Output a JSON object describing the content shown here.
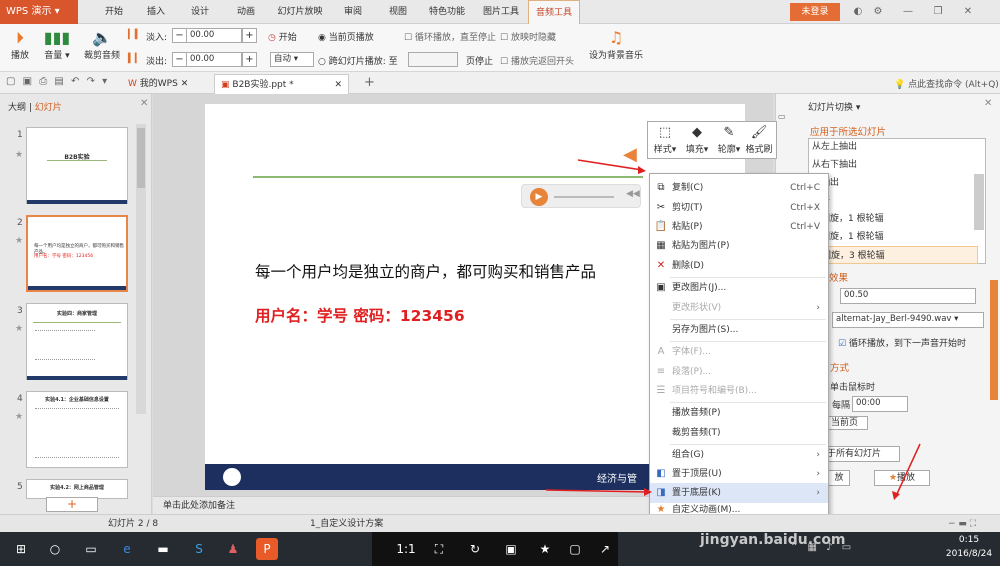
{
  "app": {
    "logo": "WPS 演示",
    "login": "未登录"
  },
  "menu_tabs": [
    "开始",
    "插入",
    "设计",
    "动画",
    "幻灯片放映",
    "审阅",
    "视图",
    "特色功能",
    "图片工具",
    "音频工具"
  ],
  "ribbon": {
    "play": "播放",
    "volume": "音量",
    "trim": "裁剪音频",
    "fade_in_label": "淡入:",
    "fade_in_value": "00.00",
    "fade_out_label": "淡出:",
    "fade_out_value": "00.00",
    "start_label": "开始",
    "start_value": "自动",
    "current_page": "当前页播放",
    "cross_slides": "跨幻灯片播放: 至",
    "page_stop": "页停止",
    "loop": "循环播放，直至停止",
    "hide_on_play": "放映时隐藏",
    "rewind": "播放完返回开头",
    "bg_music": "设为背景音乐"
  },
  "tabbar": {
    "mywps": "我的WPS",
    "doc": "B2B实验.ppt *",
    "search": "点此查找命令 (Alt+Q)"
  },
  "left_panel": {
    "outline": "大纲",
    "slides": "幻灯片"
  },
  "thumbs": [
    {
      "num": "1",
      "title": "B2B实验"
    },
    {
      "num": "2",
      "line1": "每一个用户均是独立的商户，都可购买和销售产品。",
      "line2": "用户名：学号 密码：123456"
    },
    {
      "num": "3",
      "title": "实验四：商家管理"
    },
    {
      "num": "4",
      "title": "实验4.1：企业基础信息设置"
    },
    {
      "num": "5",
      "title": "实验4.2：网上商品管理"
    }
  ],
  "slide": {
    "text1": "每一个用户均是独立的商户，都可购买和销售产品",
    "text2": "用户名：学号  密码：123456",
    "footer": "经济与管"
  },
  "mini_toolbar": [
    "样式",
    "填充",
    "轮廓",
    "格式刷"
  ],
  "context_menu": [
    {
      "icon": "copy",
      "label": "复制(C)",
      "shortcut": "Ctrl+C",
      "disabled": false
    },
    {
      "icon": "cut",
      "label": "剪切(T)",
      "shortcut": "Ctrl+X",
      "disabled": false
    },
    {
      "icon": "paste",
      "label": "粘贴(P)",
      "shortcut": "Ctrl+V",
      "disabled": false
    },
    {
      "icon": "paste-image",
      "label": "粘贴为图片(P)",
      "shortcut": "",
      "disabled": false
    },
    {
      "icon": "delete",
      "label": "删除(D)",
      "shortcut": "",
      "disabled": false
    },
    {
      "icon": "change-image",
      "label": "更改图片(J)...",
      "shortcut": "",
      "disabled": false
    },
    {
      "icon": "",
      "label": "更改形状(V)",
      "shortcut": "",
      "disabled": true
    },
    {
      "icon": "",
      "label": "另存为图片(S)...",
      "shortcut": "",
      "disabled": false
    },
    {
      "icon": "font",
      "label": "字体(F)...",
      "shortcut": "",
      "disabled": true
    },
    {
      "icon": "paragraph",
      "label": "段落(P)...",
      "shortcut": "",
      "disabled": true
    },
    {
      "icon": "list",
      "label": "项目符号和编号(B)...",
      "shortcut": "",
      "disabled": true
    },
    {
      "icon": "",
      "label": "播放音频(P)",
      "shortcut": "",
      "disabled": false
    },
    {
      "icon": "",
      "label": "裁剪音频(T)",
      "shortcut": "",
      "disabled": false
    },
    {
      "icon": "",
      "label": "组合(G)",
      "shortcut": "",
      "disabled": false
    },
    {
      "icon": "bring-front",
      "label": "置于顶层(U)",
      "shortcut": "",
      "disabled": false
    },
    {
      "icon": "send-back",
      "label": "置于底层(K)",
      "shortcut": "",
      "disabled": false
    },
    {
      "icon": "animation",
      "label": "自定义动画(M)...",
      "shortcut": "",
      "disabled": false
    }
  ],
  "right_panel": {
    "title": "幻灯片切换",
    "apply_label": "应用于所选幻灯片",
    "items": [
      "从左上抽出",
      "从右下抽出",
      "上抽出",
      "展开",
      "针回旋，1 根轮辐",
      "针回旋，1 根轮辐",
      "针回旋，3 根轮辐"
    ],
    "effect_label": "切换效果",
    "speed": "00.50",
    "sound": "alternat-Jay_Berl-9490.wav",
    "loop_sound": "循环播放，到下一声音开始时",
    "method_label": "方式",
    "on_click": "单击鼠标时",
    "every_label": "每隔",
    "every_value": "00:00",
    "current_page": "当前页",
    "apply_all": "于所有幻灯片",
    "slideshow": "放",
    "play": "播放"
  },
  "status": {
    "slide": "幻灯片 2 / 8",
    "scheme": "1_自定义设计方案",
    "notes": "单击此处添加备注"
  },
  "taskbar": {
    "zoom": "1:1",
    "time": "0:15",
    "date": "2016/8/24",
    "watermark": "jingyan.baidu.com"
  }
}
